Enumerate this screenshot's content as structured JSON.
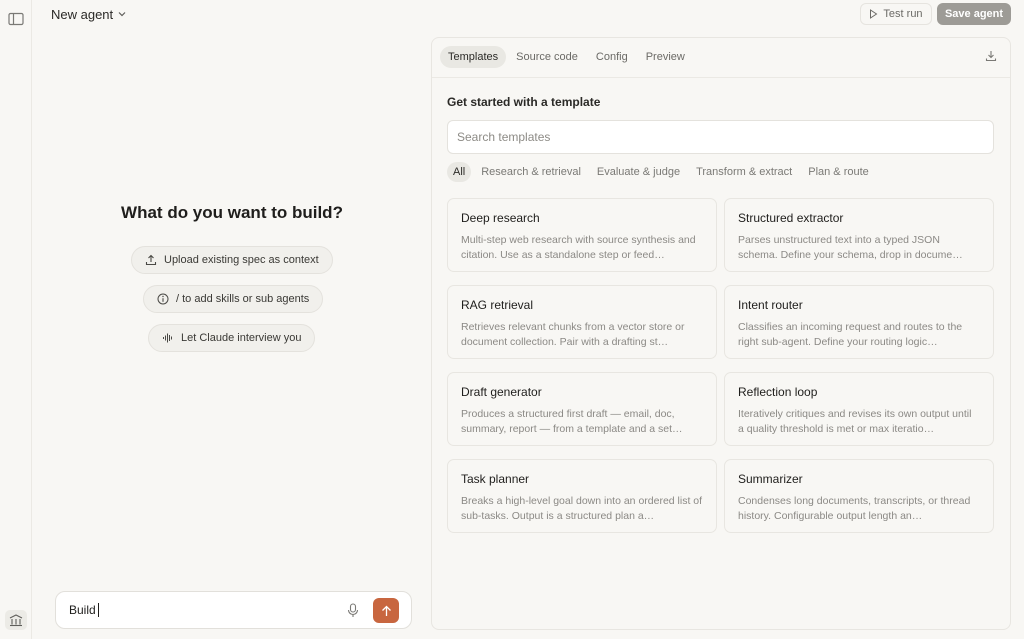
{
  "header": {
    "title": "New agent",
    "test_run_label": "Test run",
    "save_label": "Save agent"
  },
  "left": {
    "heading": "What do you want to build?",
    "actions": [
      {
        "label": "Upload existing spec as context",
        "icon": "upload-icon"
      },
      {
        "label": "/ to add skills or sub agents",
        "icon": "info-icon"
      },
      {
        "label": "Let Claude interview you",
        "icon": "waveform-icon"
      }
    ],
    "composer": {
      "value": "Build"
    }
  },
  "panel": {
    "tabs": [
      "Templates",
      "Source code",
      "Config",
      "Preview"
    ],
    "active_tab": "Templates",
    "section_title": "Get started with a template",
    "search_placeholder": "Search templates",
    "filters": [
      "All",
      "Research & retrieval",
      "Evaluate & judge",
      "Transform & extract",
      "Plan & route"
    ],
    "active_filter": "All",
    "templates": [
      {
        "title": "Deep research",
        "description": "Multi-step web research with source synthesis and citation. Use as a standalone step or feed…"
      },
      {
        "title": "Structured extractor",
        "description": "Parses unstructured text into a typed JSON schema. Define your schema, drop in docume…"
      },
      {
        "title": "RAG retrieval",
        "description": "Retrieves relevant chunks from a vector store or document collection. Pair with a drafting st…"
      },
      {
        "title": "Intent router",
        "description": "Classifies an incoming request and routes to the right sub-agent. Define your routing logic…"
      },
      {
        "title": "Draft generator",
        "description": "Produces a structured first draft — email, doc, summary, report — from a template and a set…"
      },
      {
        "title": "Reflection loop",
        "description": "Iteratively critiques and revises its own output until a quality threshold is met or max iteratio…"
      },
      {
        "title": "Task planner",
        "description": "Breaks a high-level goal down into an ordered list of sub-tasks. Output is a structured plan a…"
      },
      {
        "title": "Summarizer",
        "description": "Condenses long documents, transcripts, or thread history. Configurable output length an…"
      }
    ]
  },
  "colors": {
    "background": "#f8f7f4",
    "accent": "#c8663f",
    "save_button": "#9d9b96"
  }
}
